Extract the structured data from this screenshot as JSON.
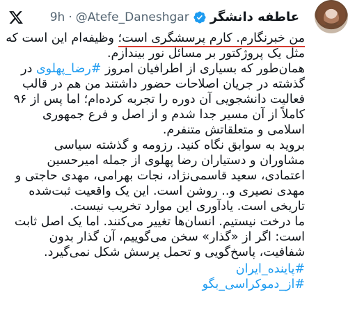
{
  "header": {
    "display_name": "عاطفه دانشگر",
    "handle": "@Atefe_Daneshgar",
    "separator": "·",
    "time": "9h"
  },
  "icons": {
    "logo": "x-logo-icon",
    "verified": "verified-badge-icon",
    "avatar": "profile-photo"
  },
  "colors": {
    "verified": "#1d9bf0",
    "hashtag": "#1d9bf0",
    "underline": "#d63a2f",
    "secondary_text": "#536471"
  },
  "tweet": {
    "p1_underlined": "من خبرنگارم. کارم پرسشگری است؛",
    "p1_rest": " وظیفه‌ام این است که مثل یک پروژکتور بر مسائل نور بیندازم.",
    "p2_before": "همان‌طور که بسیاری از اطرافیان امروز ",
    "p2_hashtag": "#رضا_پهلوی",
    "p2_after": " در گذشته در جریان اصلاحات حضور داشتند من هم در قالب فعالیت دانشجویی  آن دوره را تجربه کرده‌ام؛ اما پس از ۹۶ کاملاً از آن مسیر جدا شدم و از اصل و فرع جمهوری اسلامی و متعلقاتش متنفرم.",
    "p3": "بروید به سوابق نگاه کنید. رزومه و گذشته سیاسی مشاوران و دستیاران رضا پهلوی از جمله امیرحسین اعتمادی، سعید قاسمی‌نژاد، نجات بهرامی، مهدی حاجتی و مهدی نصیری و.. روشن است. این یک واقعیت ثبت‌شده تاریخی است. یادآوری این موارد تخریب نیست.",
    "p4": "ما درخت نیستیم. انسان‌ها تغییر می‌کنند. اما یک اصل ثابت است: اگر از «گذار» سخن می‌گوییم، آن گذار بدون شفافیت، پاسخ‌گویی و تحمل پرسش شکل نمی‌گیرد.",
    "hashtags": [
      "#پاینده_ایران",
      "#از_دموکراسی_بگو"
    ]
  }
}
